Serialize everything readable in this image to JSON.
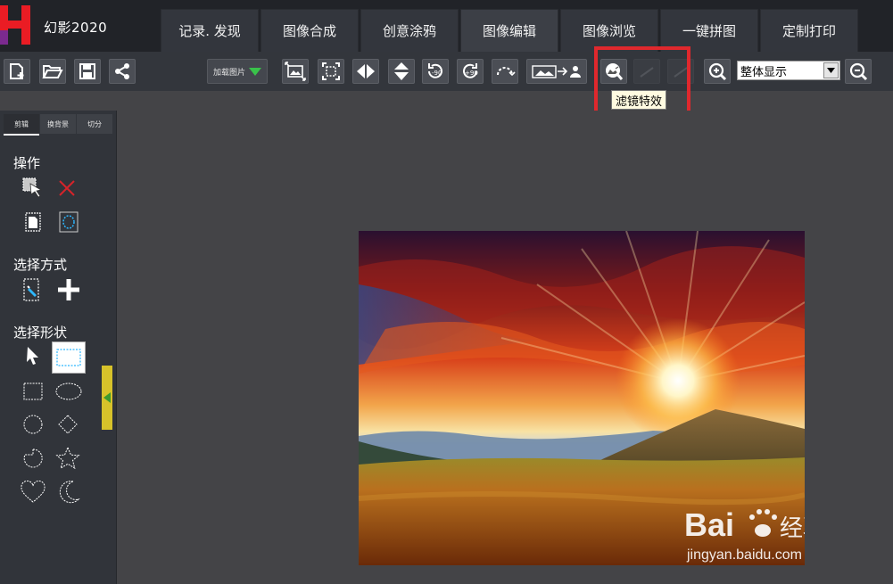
{
  "app": {
    "title": "幻影2020",
    "logo": "logo-mark"
  },
  "tabs": [
    {
      "label": "记录. 发现",
      "active": false
    },
    {
      "label": "图像合成",
      "active": false
    },
    {
      "label": "创意涂鸦",
      "active": false
    },
    {
      "label": "图像编辑",
      "active": true
    },
    {
      "label": "图像浏览",
      "active": false
    },
    {
      "label": "一键拼图",
      "active": false
    },
    {
      "label": "定制打印",
      "active": false
    }
  ],
  "toolbar": {
    "load_label": "加载图片",
    "zoom_selected": "整体显示",
    "tooltip": "滤镜特效",
    "highlight_color": "#e0282d"
  },
  "left_panel": {
    "subtabs": [
      "剪辑",
      "换背景",
      "切分"
    ],
    "sections": {
      "operation": "操作",
      "select_mode": "选择方式",
      "select_shape": "选择形状"
    }
  },
  "watermark": {
    "brand": "Bai",
    "brand_suffix": "经验",
    "url": "jingyan.baidu.com"
  },
  "colors": {
    "background": "#444447",
    "titlebar": "#212328",
    "toolbar": "#33363c",
    "handle": "#d7c22a"
  }
}
